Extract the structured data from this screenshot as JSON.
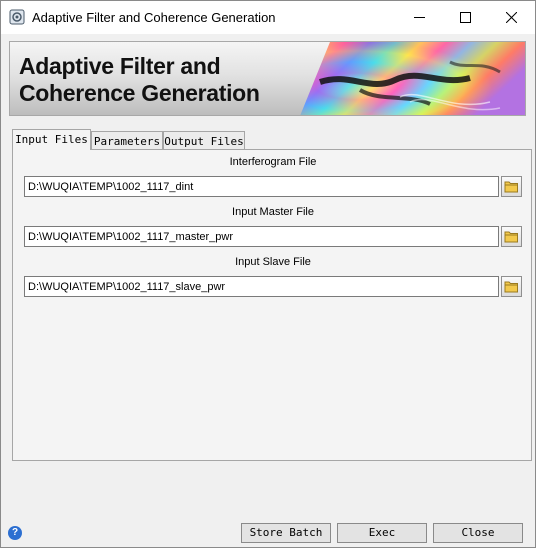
{
  "window": {
    "title": "Adaptive Filter and Coherence Generation"
  },
  "banner": {
    "title_line1": "Adaptive Filter and",
    "title_line2": "Coherence Generation"
  },
  "tabs": [
    {
      "label": "Input Files",
      "active": true
    },
    {
      "label": "Parameters",
      "active": false
    },
    {
      "label": "Output Files",
      "active": false
    }
  ],
  "fields": [
    {
      "label": "Interferogram File",
      "value": "D:\\WUQIA\\TEMP\\1002_1117_dint"
    },
    {
      "label": "Input Master File",
      "value": "D:\\WUQIA\\TEMP\\1002_1117_master_pwr"
    },
    {
      "label": "Input Slave File",
      "value": "D:\\WUQIA\\TEMP\\1002_1117_slave_pwr"
    }
  ],
  "buttons": {
    "store_batch": "Store Batch",
    "exec": "Exec",
    "close": "Close"
  },
  "help": {
    "glyph": "?"
  },
  "icons": {
    "app": "app-icon",
    "folder": "folder-icon",
    "help": "help-icon"
  }
}
